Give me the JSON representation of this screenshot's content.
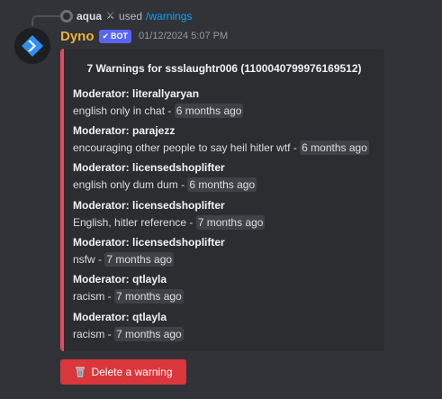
{
  "reply": {
    "user": "aqua",
    "used_text": "used",
    "command": "/warnings"
  },
  "author": {
    "name": "Dyno",
    "bot_tag": "BOT",
    "timestamp": "01/12/2024 5:07 PM"
  },
  "embed": {
    "accent_color": "#e44c58",
    "title": "7 Warnings for ssslaughtr006 (1100040799976169512)",
    "fields": [
      {
        "name": "Moderator: literallyaryan",
        "reason": "english only in chat",
        "sep": " - ",
        "time": "6 months ago"
      },
      {
        "name": "Moderator: parajezz",
        "reason": "encouraging other people to say heil hitler wtf",
        "sep": " - ",
        "time": "6 months ago"
      },
      {
        "name": "Moderator: licensedshoplifter",
        "reason": "english only dum dum",
        "sep": " - ",
        "time": "6 months ago"
      },
      {
        "name": "Moderator: licensedshoplifter",
        "reason": "English, hitler reference",
        "sep": " - ",
        "time": "7 months ago"
      },
      {
        "name": "Moderator: licensedshoplifter",
        "reason": "nsfw",
        "sep": " - ",
        "time": "7 months ago"
      },
      {
        "name": "Moderator: qtlayla",
        "reason": "racism",
        "sep": " - ",
        "time": "7 months ago"
      },
      {
        "name": "Moderator: qtlayla",
        "reason": "racism",
        "sep": " - ",
        "time": "7 months ago"
      }
    ]
  },
  "button": {
    "label": "Delete a warning",
    "icon": "wastebasket-icon",
    "color": "#da373c"
  },
  "colors": {
    "background": "#313338",
    "username": "#f0b232",
    "bot_tag": "#5865f2",
    "link": "#00a8fc"
  }
}
